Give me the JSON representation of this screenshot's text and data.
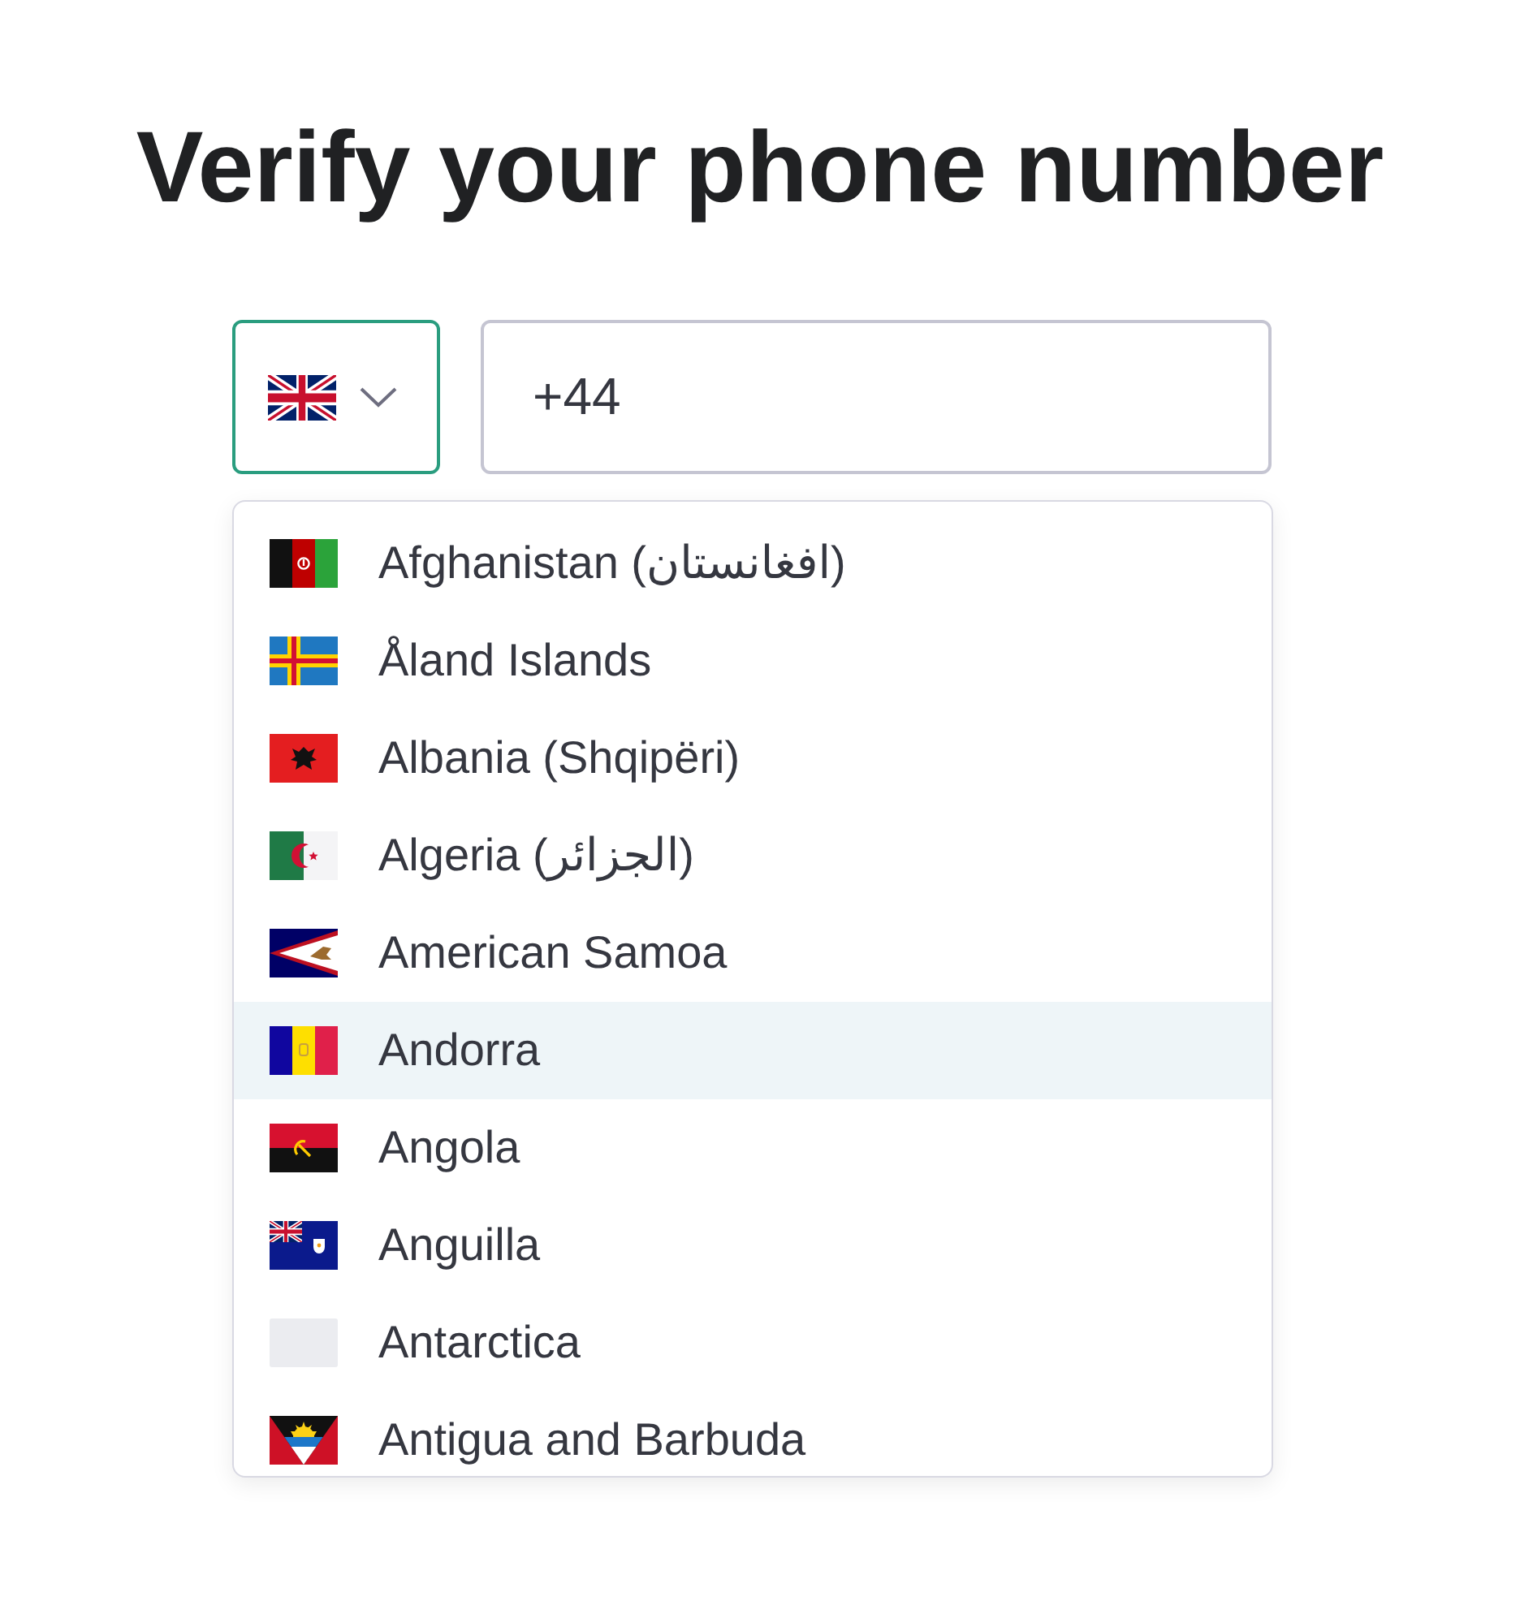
{
  "title": "Verify your phone number",
  "country_select": {
    "expanded": true
  },
  "phone": {
    "value": "+44"
  },
  "countries": [
    {
      "name": "Afghanistan (افغانستان)",
      "selected": false
    },
    {
      "name": "Åland Islands",
      "selected": false
    },
    {
      "name": "Albania (Shqipëri)",
      "selected": false
    },
    {
      "name": "Algeria (الجزائر)",
      "selected": false
    },
    {
      "name": "American Samoa",
      "selected": false
    },
    {
      "name": "Andorra",
      "selected": true
    },
    {
      "name": "Angola",
      "selected": false
    },
    {
      "name": "Anguilla",
      "selected": false
    },
    {
      "name": "Antarctica",
      "selected": false
    },
    {
      "name": "Antigua and Barbuda",
      "selected": false
    }
  ]
}
